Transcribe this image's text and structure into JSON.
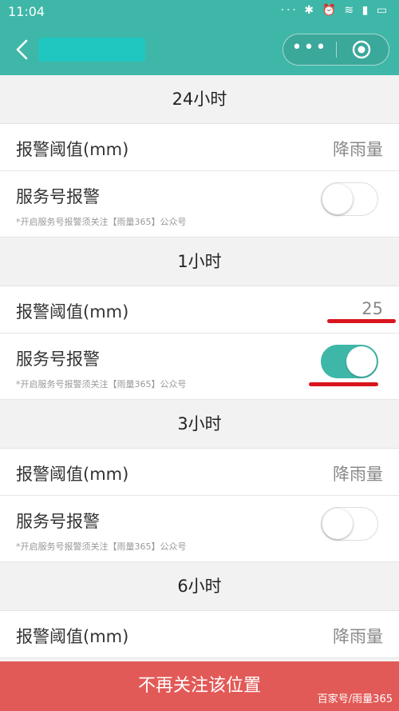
{
  "statusbar": {
    "time": "11:04",
    "icons": [
      "more-dots-icon",
      "bluetooth-icon",
      "alarm-icon",
      "wifi-icon",
      "signal-icon",
      "battery-icon"
    ]
  },
  "navbar": {
    "more_label": "•••"
  },
  "sections": [
    {
      "header": "24小时",
      "threshold_label": "报警阈值(mm)",
      "threshold_value": "降雨量",
      "service_label": "服务号报警",
      "service_note": "*开启服务号报警须关注【雨量365】公众号",
      "service_on": false
    },
    {
      "header": "1小时",
      "threshold_label": "报警阈值(mm)",
      "threshold_value": "25",
      "service_label": "服务号报警",
      "service_note": "*开启服务号报警须关注【雨量365】公众号",
      "service_on": true
    },
    {
      "header": "3小时",
      "threshold_label": "报警阈值(mm)",
      "threshold_value": "降雨量",
      "service_label": "服务号报警",
      "service_note": "*开启服务号报警须关注【雨量365】公众号",
      "service_on": false
    },
    {
      "header": "6小时",
      "threshold_label": "报警阈值(mm)",
      "threshold_value": "降雨量"
    }
  ],
  "bottom": {
    "button_label": "不再关注该位置",
    "watermark": "百家号/雨量365"
  },
  "colors": {
    "accent": "#3fb7a8",
    "danger": "#e25a57",
    "annotation": "#d9161d"
  }
}
